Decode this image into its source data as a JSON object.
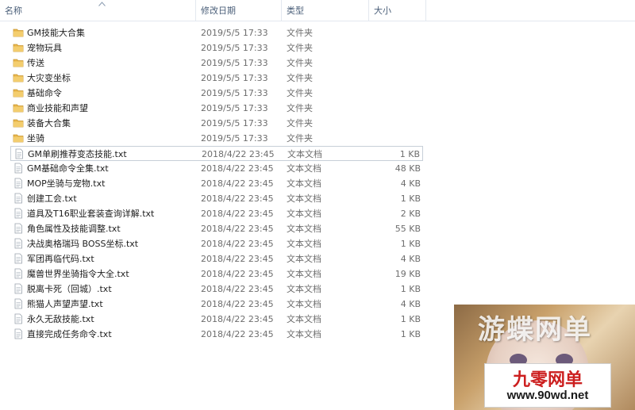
{
  "columns": {
    "name": "名称",
    "date": "修改日期",
    "type": "类型",
    "size": "大小"
  },
  "files": [
    {
      "name": "GM技能大合集",
      "date": "2019/5/5 17:33",
      "type": "文件夹",
      "size": "",
      "icon": "folder-icon"
    },
    {
      "name": "宠物玩具",
      "date": "2019/5/5 17:33",
      "type": "文件夹",
      "size": "",
      "icon": "folder-icon"
    },
    {
      "name": "传送",
      "date": "2019/5/5 17:33",
      "type": "文件夹",
      "size": "",
      "icon": "folder-icon"
    },
    {
      "name": "大灾变坐标",
      "date": "2019/5/5 17:33",
      "type": "文件夹",
      "size": "",
      "icon": "folder-icon"
    },
    {
      "name": "基础命令",
      "date": "2019/5/5 17:33",
      "type": "文件夹",
      "size": "",
      "icon": "folder-icon"
    },
    {
      "name": "商业技能和声望",
      "date": "2019/5/5 17:33",
      "type": "文件夹",
      "size": "",
      "icon": "folder-icon"
    },
    {
      "name": "装备大合集",
      "date": "2019/5/5 17:33",
      "type": "文件夹",
      "size": "",
      "icon": "folder-icon"
    },
    {
      "name": "坐骑",
      "date": "2019/5/5 17:33",
      "type": "文件夹",
      "size": "",
      "icon": "folder-icon"
    },
    {
      "name": "GM单刷推荐变态技能.txt",
      "date": "2018/4/22 23:45",
      "type": "文本文档",
      "size": "1 KB",
      "icon": "text-file-icon",
      "selected": true
    },
    {
      "name": "GM基础命令全集.txt",
      "date": "2018/4/22 23:45",
      "type": "文本文档",
      "size": "48 KB",
      "icon": "text-file-icon"
    },
    {
      "name": "MOP坐骑与宠物.txt",
      "date": "2018/4/22 23:45",
      "type": "文本文档",
      "size": "4 KB",
      "icon": "text-file-icon"
    },
    {
      "name": "创建工会.txt",
      "date": "2018/4/22 23:45",
      "type": "文本文档",
      "size": "1 KB",
      "icon": "text-file-icon"
    },
    {
      "name": "道具及T16职业套装查询详解.txt",
      "date": "2018/4/22 23:45",
      "type": "文本文档",
      "size": "2 KB",
      "icon": "text-file-icon"
    },
    {
      "name": "角色属性及技能调整.txt",
      "date": "2018/4/22 23:45",
      "type": "文本文档",
      "size": "55 KB",
      "icon": "text-file-icon"
    },
    {
      "name": "决战奥格瑞玛 BOSS坐标.txt",
      "date": "2018/4/22 23:45",
      "type": "文本文档",
      "size": "1 KB",
      "icon": "text-file-icon"
    },
    {
      "name": "军团再临代码.txt",
      "date": "2018/4/22 23:45",
      "type": "文本文档",
      "size": "4 KB",
      "icon": "text-file-icon"
    },
    {
      "name": "魔兽世界坐骑指令大全.txt",
      "date": "2018/4/22 23:45",
      "type": "文本文档",
      "size": "19 KB",
      "icon": "text-file-icon"
    },
    {
      "name": "脱离卡死（回城）.txt",
      "date": "2018/4/22 23:45",
      "type": "文本文档",
      "size": "1 KB",
      "icon": "text-file-icon"
    },
    {
      "name": "熊猫人声望声望.txt",
      "date": "2018/4/22 23:45",
      "type": "文本文档",
      "size": "4 KB",
      "icon": "text-file-icon"
    },
    {
      "name": "永久无敌技能.txt",
      "date": "2018/4/22 23:45",
      "type": "文本文档",
      "size": "1 KB",
      "icon": "text-file-icon"
    },
    {
      "name": "直接完成任务命令.txt",
      "date": "2018/4/22 23:45",
      "type": "文本文档",
      "size": "1 KB",
      "icon": "text-file-icon"
    }
  ],
  "watermark": {
    "top_text": "游蝶网单",
    "title": "九零网单",
    "url": "www.90wd.net"
  }
}
